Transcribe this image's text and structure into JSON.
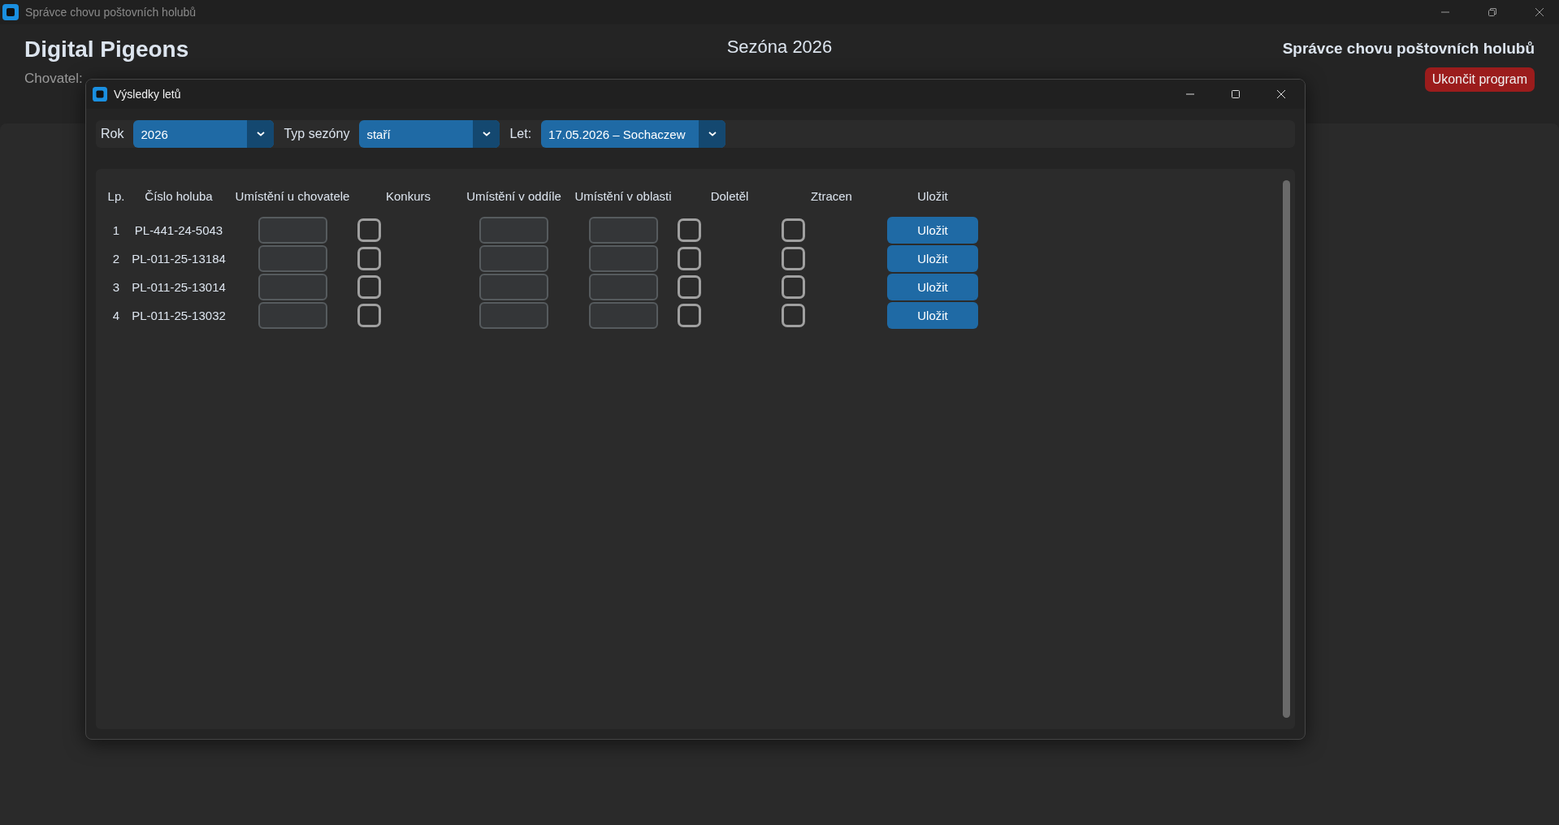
{
  "window": {
    "title": "Správce chovu poštovních holubů"
  },
  "header": {
    "app_name": "Digital Pigeons",
    "breeder_label": "Chovatel:",
    "season": "Sezóna 2026",
    "program_title": "Správce chovu poštovních holubů",
    "exit_button": "Ukončit program"
  },
  "dialog": {
    "title": "Výsledky letů",
    "filters": [
      {
        "label": "Rok",
        "value": "2026"
      },
      {
        "label": "Typ sezóny",
        "value": "staří"
      },
      {
        "label": "Let:",
        "value": "17.05.2026 – Sochaczew"
      }
    ],
    "table": {
      "columns": [
        "Lp.",
        "Číslo holuba",
        "Umístění u chovatele",
        "Konkurs",
        "Umístění v oddíle",
        "Umístění v oblasti",
        "Doletěl",
        "Ztracen",
        "Uložit"
      ],
      "rows": [
        {
          "index": "1",
          "ring": "PL-441-24-5043",
          "konkurs": false,
          "doletel": false,
          "ztracen": false,
          "button": "Uložit"
        },
        {
          "index": "2",
          "ring": "PL-011-25-13184",
          "konkurs": false,
          "doletel": false,
          "ztracen": false,
          "button": "Uložit"
        },
        {
          "index": "3",
          "ring": "PL-011-25-13014",
          "konkurs": false,
          "doletel": false,
          "ztracen": false,
          "button": "Uložit"
        },
        {
          "index": "4",
          "ring": "PL-011-25-13032",
          "konkurs": false,
          "doletel": false,
          "ztracen": false,
          "button": "Uložit"
        }
      ]
    }
  }
}
